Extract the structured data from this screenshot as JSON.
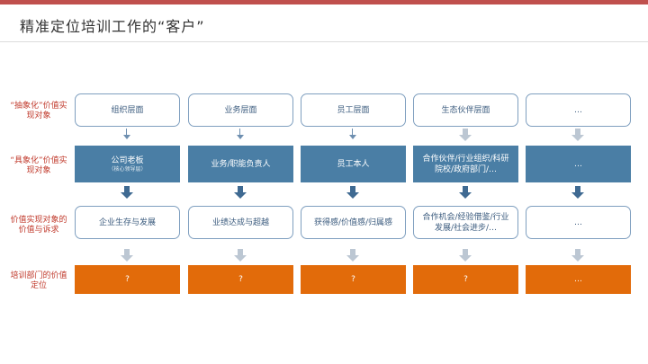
{
  "title": "精准定位培训工作的“客户”",
  "row_labels": [
    "“抽象化”价值实现对象",
    "“具象化”价值实现对象",
    "价值实现对象的价值与诉求",
    "培训部门的价值定位"
  ],
  "rows": [
    [
      "组织层面",
      "业务层面",
      "员工层面",
      "生态伙伴层面",
      "…"
    ],
    [
      {
        "main": "公司老板",
        "sub": "（核心领导层）"
      },
      {
        "main": "业务/职能负责人",
        "sub": ""
      },
      {
        "main": "员工本人",
        "sub": ""
      },
      {
        "main": "合作伙伴/行业组织/科研院校/政府部门/…",
        "sub": ""
      },
      {
        "main": "…",
        "sub": ""
      }
    ],
    [
      "企业生存与发展",
      "业绩达成与超越",
      "获得感/价值感/归属感",
      "合作机会/经验借鉴/行业发展/社会进步/…",
      "…"
    ],
    [
      "?",
      "?",
      "?",
      "?",
      "…"
    ]
  ],
  "colors": {
    "accent_red": "#c0504d",
    "blue": "#4a7ea5",
    "orange": "#e26b0a",
    "outline": "#7f9fbf"
  }
}
